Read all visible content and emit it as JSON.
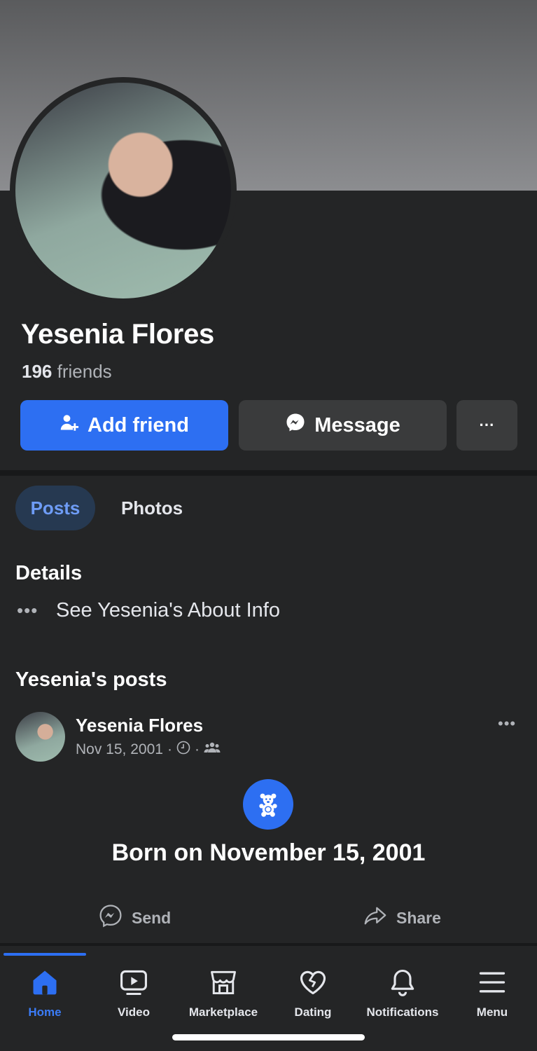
{
  "profile": {
    "name": "Yesenia Flores",
    "friends_count": "196",
    "friends_label": "friends"
  },
  "actions": {
    "add_friend": "Add friend",
    "message": "Message",
    "more": "···"
  },
  "tabs": [
    {
      "label": "Posts",
      "active": true
    },
    {
      "label": "Photos",
      "active": false
    }
  ],
  "details": {
    "heading": "Details",
    "about_dots": "•••",
    "about_link": "See Yesenia's About Info"
  },
  "posts": {
    "heading": "Yesenia's posts",
    "author": "Yesenia Flores",
    "date": "Nov 15, 2001",
    "separator": "·",
    "more": "•••",
    "life_event_icon": "teddy-bear-icon",
    "life_event_text": "Born on November 15, 2001",
    "send_label": "Send",
    "share_label": "Share"
  },
  "bottom_nav": [
    {
      "label": "Home",
      "icon": "home-icon",
      "active": true
    },
    {
      "label": "Video",
      "icon": "video-icon",
      "active": false
    },
    {
      "label": "Marketplace",
      "icon": "marketplace-icon",
      "active": false
    },
    {
      "label": "Dating",
      "icon": "dating-icon",
      "active": false
    },
    {
      "label": "Notifications",
      "icon": "bell-icon",
      "active": false
    },
    {
      "label": "Menu",
      "icon": "menu-icon",
      "active": false
    }
  ],
  "colors": {
    "background": "#242526",
    "accent": "#2d6ff2",
    "secondary_button": "#3a3b3c",
    "muted_text": "#b0b3b8"
  }
}
